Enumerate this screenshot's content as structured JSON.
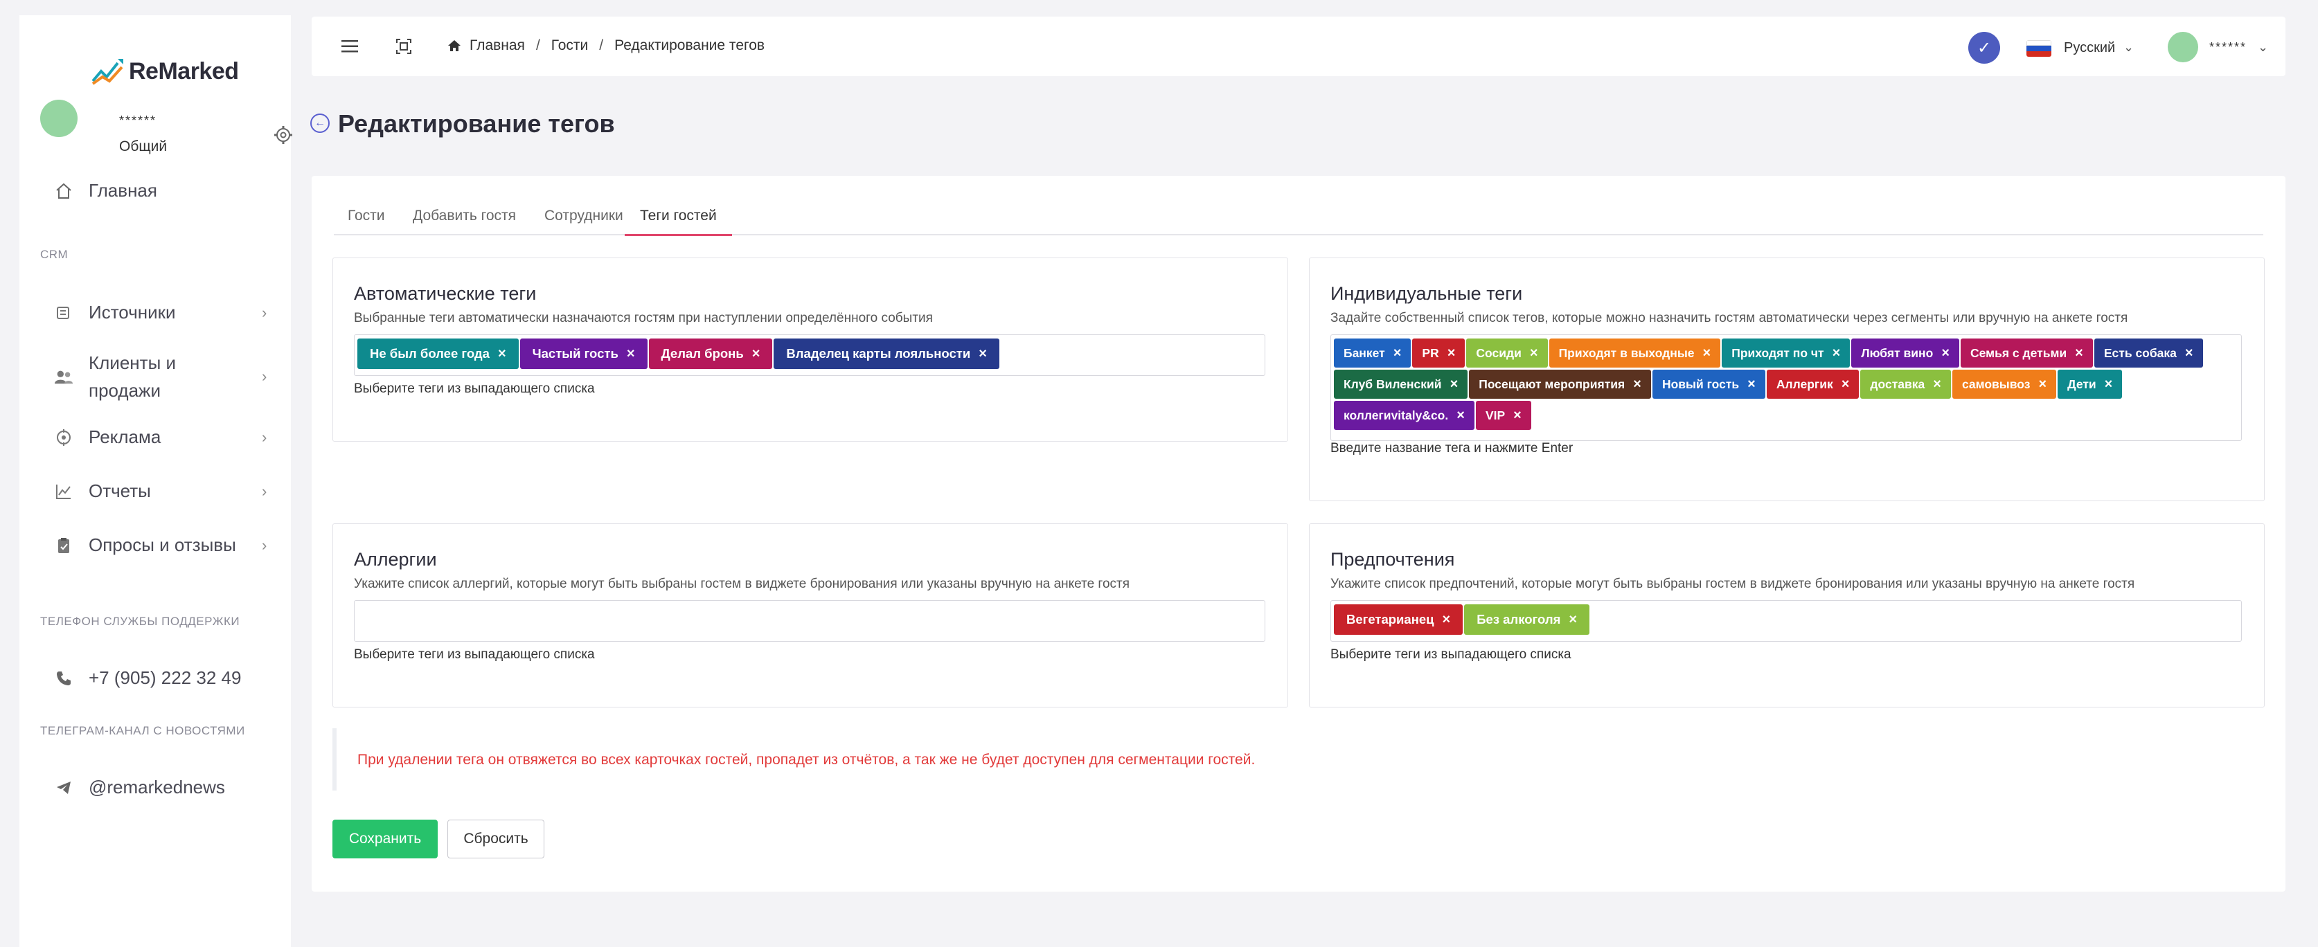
{
  "app": {
    "name": "ReMarked"
  },
  "sidebar": {
    "user": {
      "name": "******",
      "role": "Общий"
    },
    "items": [
      {
        "label": "Главная"
      },
      {
        "label": "Источники"
      },
      {
        "label": "Клиенты и продажи"
      },
      {
        "label": "Реклама"
      },
      {
        "label": "Отчеты"
      },
      {
        "label": "Опросы и отзывы"
      }
    ],
    "section_crm": "CRM",
    "support_label": "Телефон службы поддержки",
    "support_phone": "+7 (905) 222 32 49",
    "channel_label": "Телеграм-канал с новостями",
    "channel": "@remarkednews"
  },
  "header": {
    "breadcrumbs": [
      "Главная",
      "Гости",
      "Редактирование тегов"
    ],
    "language": "Русский",
    "user": "******"
  },
  "page": {
    "title": "Редактирование тегов"
  },
  "tabs": [
    {
      "label": "Гости"
    },
    {
      "label": "Добавить гостя"
    },
    {
      "label": "Сотрудники"
    },
    {
      "label": "Теги гостей",
      "active": true
    }
  ],
  "auto_tags": {
    "title": "Автоматические теги",
    "desc": "Выбранные теги автоматически назначаются гостям при наступлении определённого события",
    "hint": "Выберите теги из выпадающего списка",
    "tags": [
      {
        "label": "Не был более года",
        "color": "#0e8a8e"
      },
      {
        "label": "Частый гость",
        "color": "#6a1aa0"
      },
      {
        "label": "Делал бронь",
        "color": "#b5185a"
      },
      {
        "label": "Владелец карты лояльности",
        "color": "#263a8c"
      }
    ]
  },
  "individual_tags": {
    "title": "Индивидуальные теги",
    "desc": "Задайте собственный список тегов, которые можно назначить гостям автоматически через сегменты или вручную на анкете гостя",
    "hint": "Введите название тега и нажмите Enter",
    "tags": [
      {
        "label": "Банкет",
        "color": "#1f63c0"
      },
      {
        "label": "PR",
        "color": "#c8222a"
      },
      {
        "label": "Сосиди",
        "color": "#8bbf3f"
      },
      {
        "label": "Приходят в выходные",
        "color": "#f07d1a"
      },
      {
        "label": "Приходят по чт",
        "color": "#0e8a8e"
      },
      {
        "label": "Любят вино",
        "color": "#6a1aa0"
      },
      {
        "label": "Семья с детьми",
        "color": "#b5185a"
      },
      {
        "label": "Есть собака",
        "color": "#263a8c"
      },
      {
        "label": "Клуб Виленский",
        "color": "#1b6b45"
      },
      {
        "label": "Посещают мероприятия",
        "color": "#5a3220"
      },
      {
        "label": "Новый гость",
        "color": "#1f63c0"
      },
      {
        "label": "Аллергик",
        "color": "#c8222a"
      },
      {
        "label": "доставка",
        "color": "#8bbf3f"
      },
      {
        "label": "самовывоз",
        "color": "#f07d1a"
      },
      {
        "label": "Дети",
        "color": "#0e8a8e"
      },
      {
        "label": "коллегиvitaly&co.",
        "color": "#6a1aa0"
      },
      {
        "label": "VIP",
        "color": "#b5185a"
      }
    ]
  },
  "allergies": {
    "title": "Аллергии",
    "desc": "Укажите список аллергий, которые могут быть выбраны гостем в виджете бронирования или указаны вручную на анкете гостя",
    "hint": "Выберите теги из выпадающего списка"
  },
  "preferences": {
    "title": "Предпочтения",
    "desc": "Укажите список предпочтений, которые могут быть выбраны гостем в виджете бронирования или указаны вручную на анкете гостя",
    "hint": "Выберите теги из выпадающего списка",
    "tags": [
      {
        "label": "Вегетарианец",
        "color": "#c8222a"
      },
      {
        "label": "Без алкоголя",
        "color": "#8bbf3f"
      }
    ]
  },
  "warning": "При удалении тега он отвяжется во всех карточках гостей, пропадет из отчётов, а так же не будет доступен для сегментации гостей.",
  "actions": {
    "save": "Сохранить",
    "reset": "Сбросить"
  }
}
